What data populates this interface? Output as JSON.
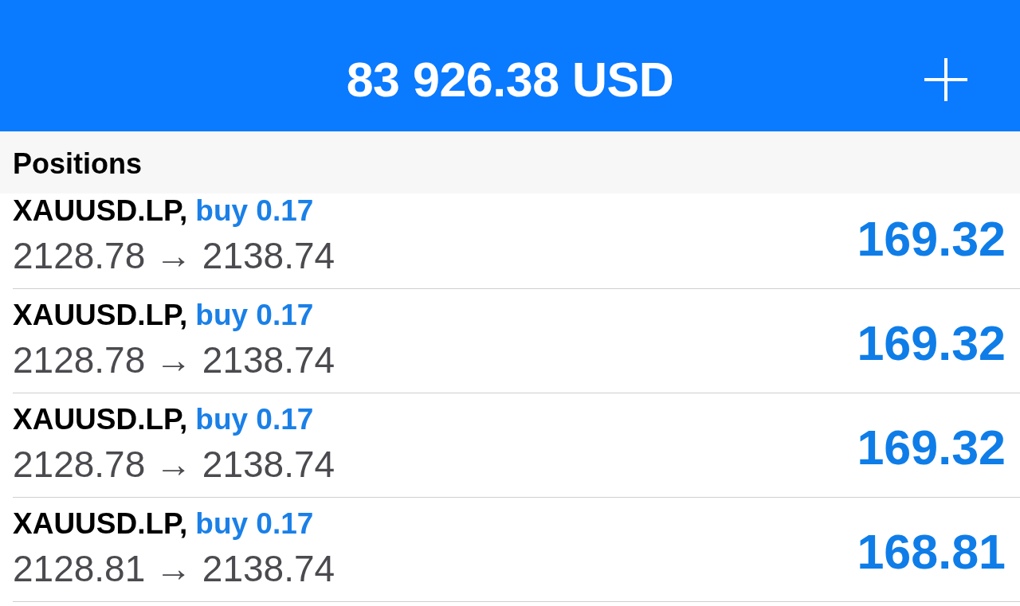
{
  "header": {
    "balance": "83 926.38 USD"
  },
  "section": {
    "title": "Positions"
  },
  "positions": [
    {
      "symbol": "XAUUSD.LP,",
      "order": "buy 0.17",
      "prices": "2128.78 → 2138.74",
      "profit": "169.32"
    },
    {
      "symbol": "XAUUSD.LP,",
      "order": "buy 0.17",
      "prices": "2128.78 → 2138.74",
      "profit": "169.32"
    },
    {
      "symbol": "XAUUSD.LP,",
      "order": "buy 0.17",
      "prices": "2128.78 → 2138.74",
      "profit": "169.32"
    },
    {
      "symbol": "XAUUSD.LP,",
      "order": "buy 0.17",
      "prices": "2128.81 → 2138.74",
      "profit": "168.81"
    }
  ]
}
